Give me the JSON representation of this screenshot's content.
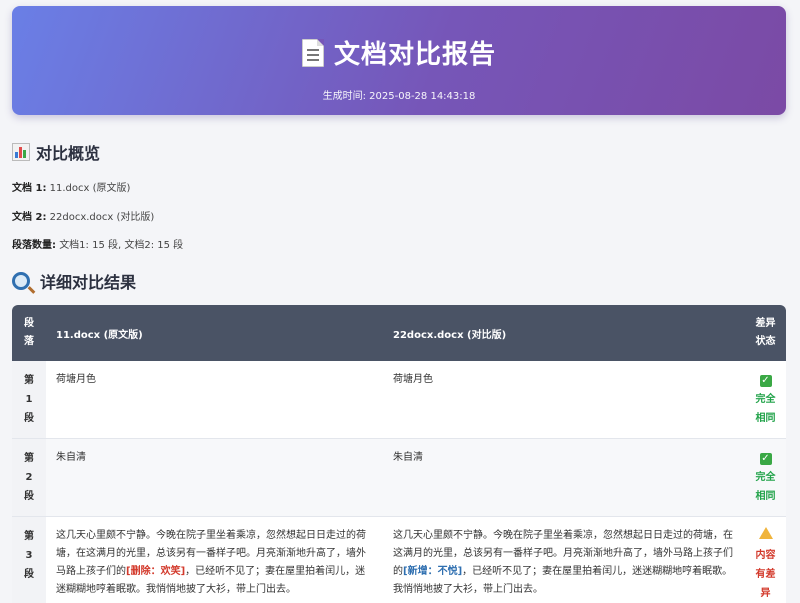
{
  "header": {
    "icon": "document-icon",
    "title": "文档对比报告",
    "subtitle": "生成时间: 2025-08-28 14:43:18",
    "gradient": [
      "#6a7fe6",
      "#7b4aa5"
    ]
  },
  "overview": {
    "heading": "对比概览",
    "heading_icon": "bar-chart-icon",
    "doc1_label": "文档 1:",
    "doc1_value": "11.docx (原文版)",
    "doc2_label": "文档 2:",
    "doc2_value": "22docx.docx (对比版)",
    "para_label": "段落数量:",
    "para_value": "文档1: 15 段, 文档2: 15 段"
  },
  "details": {
    "heading": "详细对比结果",
    "heading_icon": "magnifier-icon",
    "columns": {
      "seg": "段落",
      "doc1": "11.docx (原文版)",
      "doc2": "22docx.docx (对比版)",
      "status": "差异状态"
    },
    "rows": [
      {
        "seg": "第1段",
        "doc1": "荷塘月色",
        "doc2": "荷塘月色",
        "status": "完全相同",
        "status_icon": "check-icon"
      },
      {
        "seg": "第2段",
        "doc1": "朱自清",
        "doc2": "朱自清",
        "status": "完全相同",
        "status_icon": "check-icon"
      },
      {
        "seg": "第3段",
        "doc1_before": "这几天心里颇不宁静。今晚在院子里坐着乘凉，忽然想起日日走过的荷塘，在这满月的光里，总该另有一番样子吧。月亮渐渐地升高了，墙外马路上孩子们的",
        "doc1_mark": "[删除：欢笑]",
        "doc1_after": "，已经听不见了；妻在屋里拍着闰儿，迷迷糊糊地哼着眠歌。我悄悄地披了大衫，带上门出去。",
        "doc2_before": "这几天心里颇不宁静。今晚在院子里坐着乘凉，忽然想起日日走过的荷塘，在这满月的光里，总该另有一番样子吧。月亮渐渐地升高了，墙外马路上孩子们的",
        "doc2_mark": "[新增：不悦]",
        "doc2_after": "，已经听不见了；妻在屋里拍着闰儿，迷迷糊糊地哼着眠歌。我悄悄地披了大衫，带上门出去。",
        "status": "内容有差异",
        "status_icon": "warning-icon"
      }
    ]
  },
  "colors": {
    "same": "#22a34a",
    "diff": "#d33a2c",
    "added": "#2f6fb0",
    "table_header": "#4a5365"
  }
}
